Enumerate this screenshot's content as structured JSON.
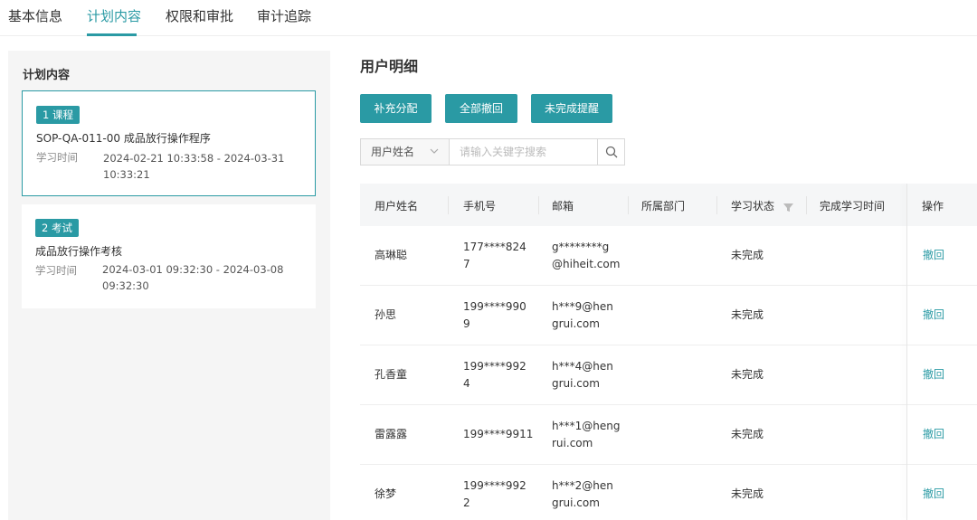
{
  "tabs": [
    {
      "label": "基本信息",
      "active": false
    },
    {
      "label": "计划内容",
      "active": true
    },
    {
      "label": "权限和审批",
      "active": false
    },
    {
      "label": "审计追踪",
      "active": false
    }
  ],
  "left_panel": {
    "title": "计划内容",
    "cards": [
      {
        "badge": "1 课程",
        "name": "SOP-QA-011-00 成品放行操作程序",
        "time_label": "学习时间",
        "time_value": "2024-02-21 10:33:58 - 2024-03-31 10:33:21",
        "selected": true
      },
      {
        "badge": "2 考试",
        "name": "成品放行操作考核",
        "time_label": "学习时间",
        "time_value": "2024-03-01 09:32:30 - 2024-03-08 09:32:30",
        "selected": false
      }
    ]
  },
  "main": {
    "title": "用户明细",
    "buttons": [
      "补充分配",
      "全部撤回",
      "未完成提醒"
    ],
    "search": {
      "field_label": "用户姓名",
      "placeholder": "请输入关键字搜索",
      "value": ""
    },
    "table": {
      "columns": [
        "用户姓名",
        "手机号",
        "邮箱",
        "所属部门",
        "学习状态",
        "完成学习时间",
        "操作"
      ],
      "rows": [
        {
          "name": "高琳聪",
          "phone": "177****824\n7",
          "email": "g********g\n@hiheit.com",
          "dept": "",
          "status": "未完成",
          "done_time": "",
          "action": "撤回"
        },
        {
          "name": "孙思",
          "phone": "199****990\n9",
          "email": "h***9@hen\ngrui.com",
          "dept": "",
          "status": "未完成",
          "done_time": "",
          "action": "撤回"
        },
        {
          "name": "孔香童",
          "phone": "199****992\n4",
          "email": "h***4@hen\ngrui.com",
          "dept": "",
          "status": "未完成",
          "done_time": "",
          "action": "撤回"
        },
        {
          "name": "雷露露",
          "phone": "199****9911",
          "email": "h***1@heng\nrui.com",
          "dept": "",
          "status": "未完成",
          "done_time": "",
          "action": "撤回"
        },
        {
          "name": "徐梦",
          "phone": "199****992\n2",
          "email": "h***2@hen\ngrui.com",
          "dept": "",
          "status": "未完成",
          "done_time": "",
          "action": "撤回"
        }
      ]
    }
  },
  "colors": {
    "accent": "#2a9aa4"
  },
  "icons": {
    "search": "search-icon",
    "chevron": "chevron-down-icon",
    "filter": "filter-icon"
  }
}
